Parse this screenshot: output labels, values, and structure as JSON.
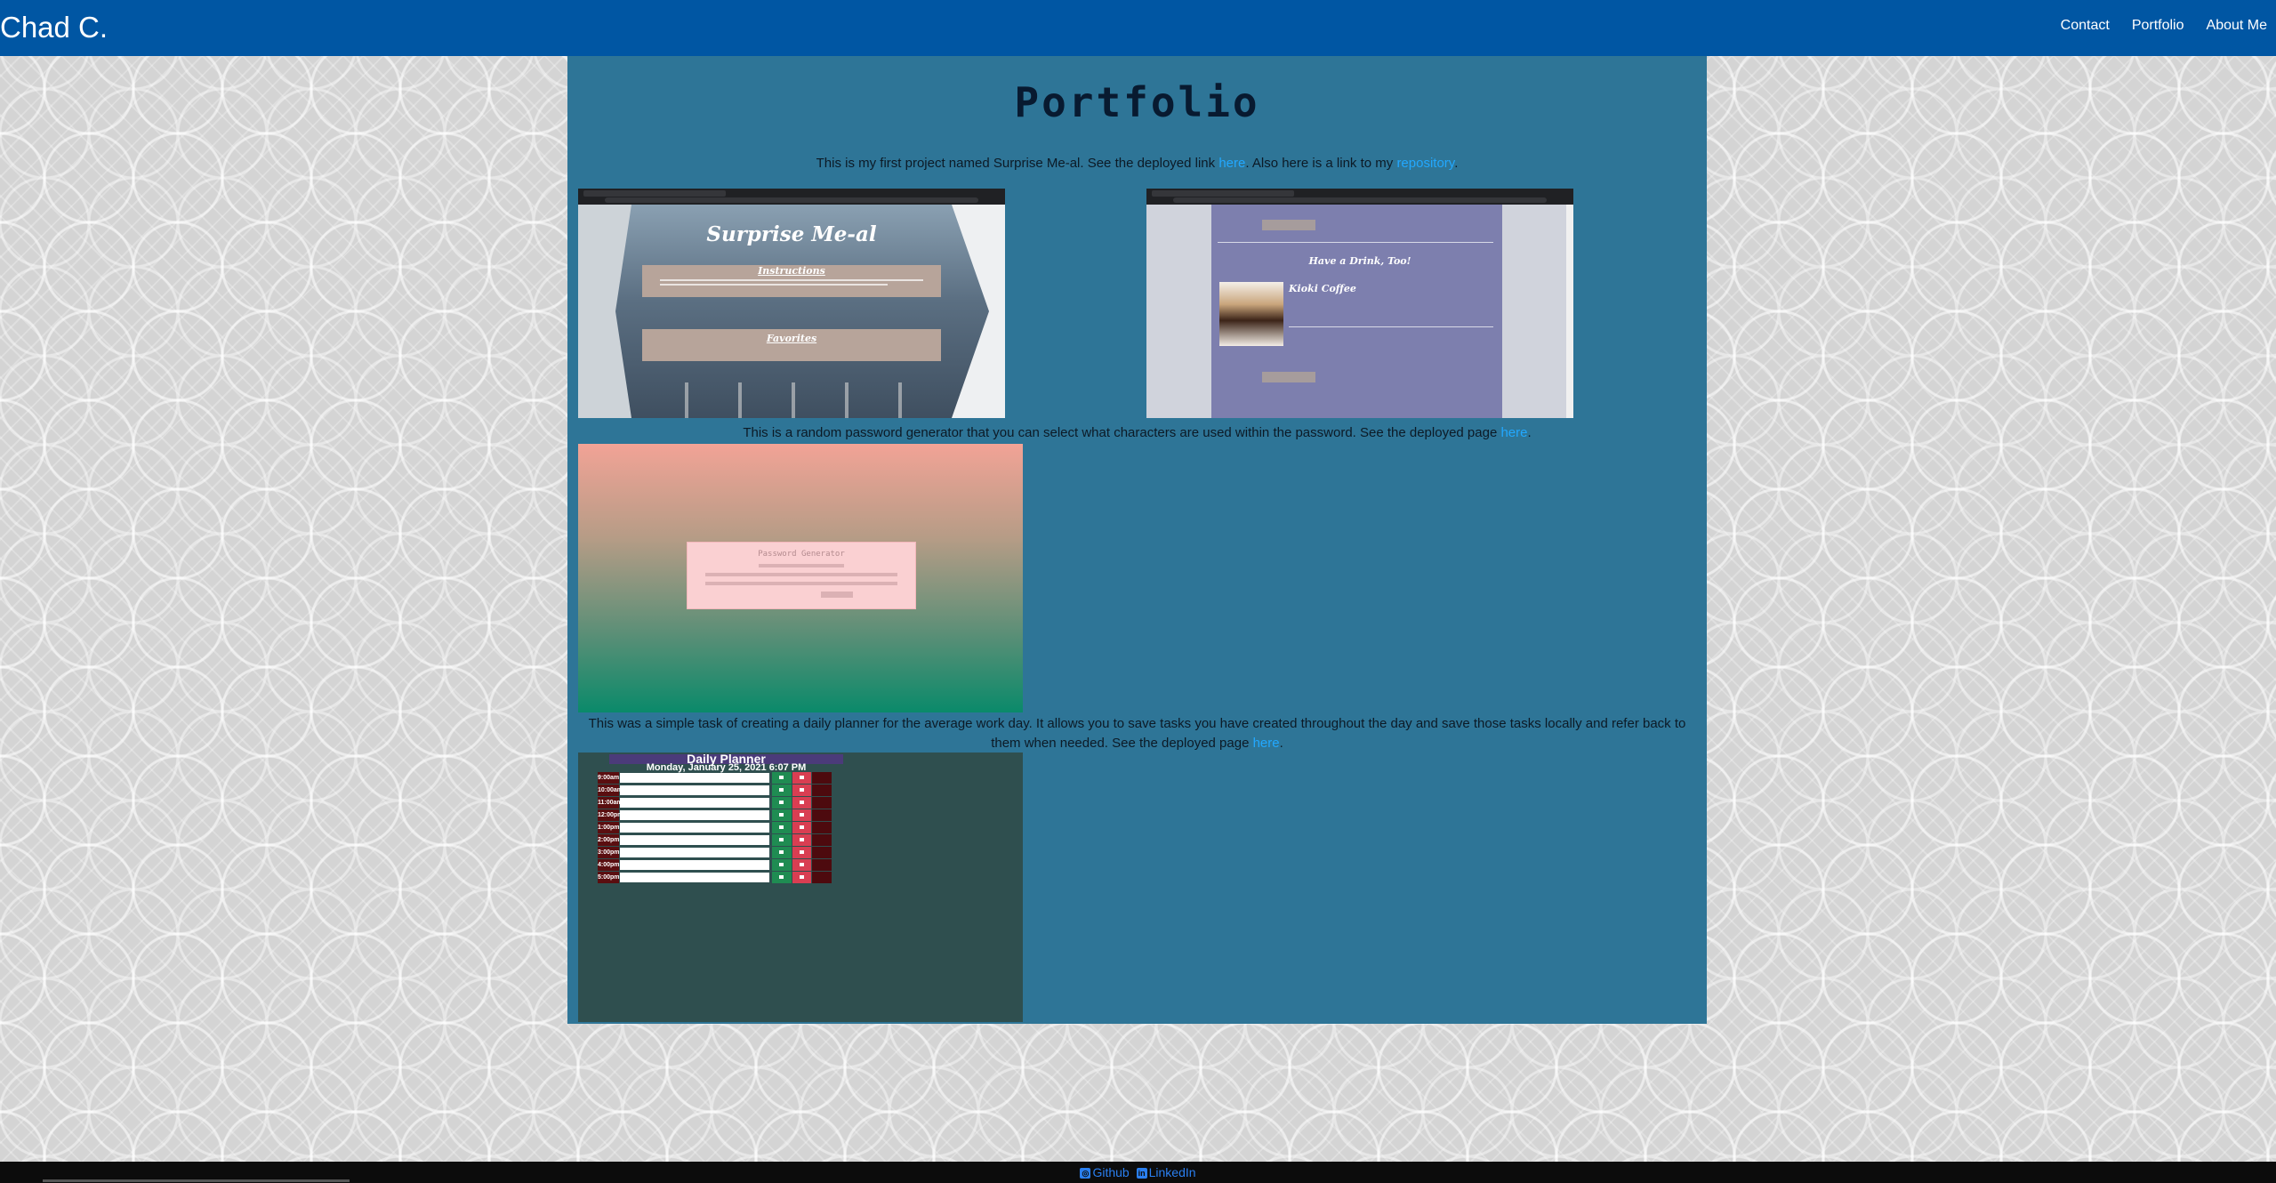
{
  "navbar": {
    "brand": "Chad C.",
    "links": [
      "Contact",
      "Portfolio",
      "About Me"
    ]
  },
  "main": {
    "title": "Portfolio",
    "project1": {
      "text_before": "This is my first project named Surprise Me-al. See the deployed link ",
      "link1": "here",
      "text_middle": ". Also here is a link to my ",
      "link2": "repository",
      "text_after": ".",
      "screenshot1": {
        "title": "Surprise Me-al",
        "box1_title": "Instructions",
        "box2_title": "Favorites"
      },
      "screenshot2": {
        "heading": "Have a Drink, Too!",
        "drink_name": "Kioki Coffee"
      }
    },
    "project2": {
      "text_before": "This is a random password generator that you can select what characters are used within the password. See the deployed page ",
      "link": "here",
      "text_after": ".",
      "card_title": "Password Generator"
    },
    "project3": {
      "text_before": "This was a simple task of creating a daily planner for the average work day. It allows you to save tasks you have created throughout the day and save those tasks locally and refer back to them when needed. See the deployed page ",
      "link": "here",
      "text_after": ".",
      "planner_title": "Daily Planner",
      "planner_date": "Monday, January 25, 2021 6:07 PM",
      "hours": [
        "9:00am",
        "10:00am",
        "11:00am",
        "12:00pm",
        "1:00pm",
        "2:00pm",
        "3:00pm",
        "4:00pm",
        "5:00pm"
      ]
    }
  },
  "footer": {
    "github": "Github",
    "linkedin": "LinkedIn"
  },
  "colors": {
    "navbar": "#0056a3",
    "main_bg": "#2e7597",
    "link": "#22a8ff"
  }
}
